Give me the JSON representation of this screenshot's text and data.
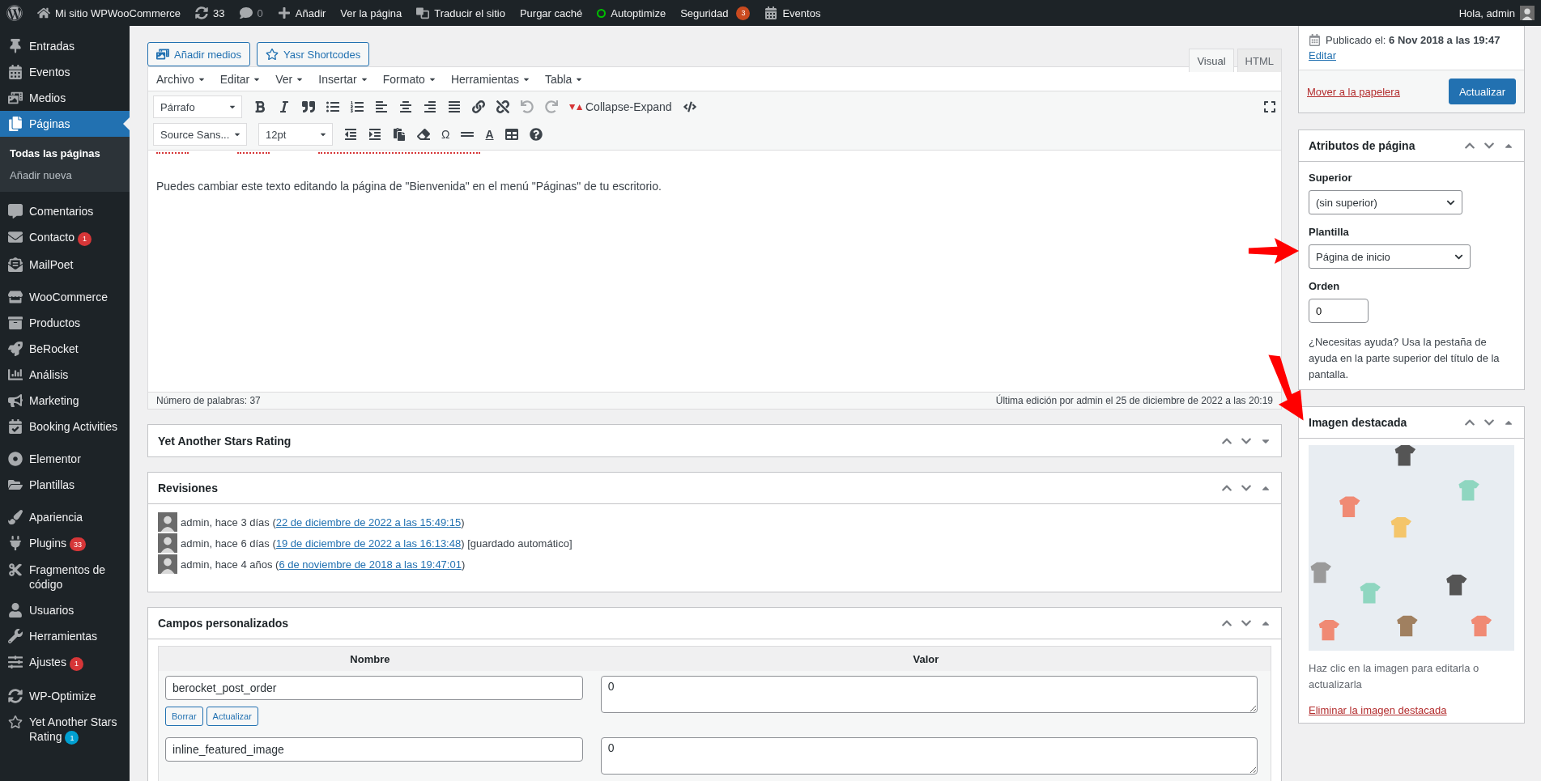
{
  "admin_bar": {
    "items": [
      {
        "kind": "logo"
      },
      {
        "kind": "icon_text",
        "label": "Mi sitio WPWooCommerce"
      },
      {
        "kind": "icon_text",
        "label": "33"
      },
      {
        "kind": "icon_count",
        "label": "0"
      },
      {
        "kind": "icon_text",
        "label": "Añadir"
      },
      {
        "kind": "text",
        "label": "Ver la página"
      },
      {
        "kind": "icon_text",
        "label": "Traducir el sitio"
      },
      {
        "kind": "text",
        "label": "Purgar caché"
      },
      {
        "kind": "status",
        "label": "Autoptimize"
      },
      {
        "kind": "badge",
        "label": "Seguridad",
        "badge": "3"
      },
      {
        "kind": "icon_text",
        "label": "Eventos"
      }
    ],
    "greeting": "Hola, admin"
  },
  "sidebar": {
    "groups": [
      [
        {
          "label": "Entradas",
          "selected": false
        },
        {
          "label": "Eventos",
          "selected": false
        },
        {
          "label": "Medios",
          "selected": false
        },
        {
          "label": "Páginas",
          "selected": true,
          "children": [
            {
              "label": "Todas las páginas",
              "selected": true
            },
            {
              "label": "Añadir nueva",
              "selected": false
            }
          ]
        }
      ],
      [
        {
          "label": "Comentarios",
          "selected": false
        },
        {
          "label": "Contacto",
          "selected": false,
          "badge": "1",
          "color": "#d63638"
        },
        {
          "label": "MailPoet",
          "selected": false
        }
      ],
      [
        {
          "label": "WooCommerce",
          "selected": false
        },
        {
          "label": "Productos",
          "selected": false
        },
        {
          "label": "BeRocket",
          "selected": false
        },
        {
          "label": "Análisis",
          "selected": false
        },
        {
          "label": "Marketing",
          "selected": false
        },
        {
          "label": "Booking Activities",
          "selected": false
        }
      ],
      [
        {
          "label": "Elementor",
          "selected": false
        },
        {
          "label": "Plantillas",
          "selected": false
        }
      ],
      [
        {
          "label": "Apariencia",
          "selected": false
        },
        {
          "label": "Plugins",
          "selected": false,
          "badge": "33",
          "color": "#d63638"
        },
        {
          "label": "Fragmentos de código",
          "selected": false
        },
        {
          "label": "Usuarios",
          "selected": false
        },
        {
          "label": "Herramientas",
          "selected": false
        },
        {
          "label": "Ajustes",
          "selected": false,
          "badge": "1",
          "color": "#d63638"
        }
      ],
      [
        {
          "label": "WP-Optimize",
          "selected": false
        },
        {
          "label": "Yet Another Stars Rating",
          "selected": false,
          "badge": "1",
          "color": "#00a0d2"
        }
      ]
    ]
  },
  "editor": {
    "media_buttons": [
      "Añadir medios",
      "Yasr Shortcodes"
    ],
    "tabs": [
      {
        "label": "Visual",
        "selected": true
      },
      {
        "label": "HTML",
        "selected": false
      }
    ],
    "menubar": [
      "Archivo",
      "Editar",
      "Ver",
      "Insertar",
      "Formato",
      "Herramientas",
      "Tabla"
    ],
    "toolbar": {
      "format_select": "Párrafo",
      "collapse_label": "Collapse-Expand",
      "font_select": "Source Sans...",
      "size_select": "12pt",
      "special_char": "Ω",
      "text_color": "A"
    },
    "content": "Puedes cambiar este texto editando la página de \"Bienvenida\" en el menú \"Páginas\" de tu escritorio.",
    "word_count": "Número de palabras: 37",
    "last_edit": "Última edición por admin el 25 de diciembre de 2022 a las 20:19"
  },
  "yasr_box": {
    "title": "Yet Another Stars Rating",
    "expanded": false
  },
  "revisions_box": {
    "title": "Revisiones",
    "expanded": true,
    "items": [
      {
        "before": "admin, hace 3 días (",
        "link": "22 de diciembre de 2022 a las 15:49:15",
        "after": ")"
      },
      {
        "before": "admin, hace 6 días (",
        "link": "19 de diciembre de 2022 a las 16:13:48",
        "after": ") [guardado automático]"
      },
      {
        "before": "admin, hace 4 años (",
        "link": "6 de noviembre de 2018 a las 19:47:01",
        "after": ")"
      }
    ]
  },
  "custom_fields_box": {
    "title": "Campos personalizados",
    "expanded": true,
    "columns": [
      "Nombre",
      "Valor"
    ],
    "rows": [
      {
        "name": "berocket_post_order",
        "value": "0",
        "buttons": [
          "Borrar",
          "Actualizar"
        ]
      },
      {
        "name": "inline_featured_image",
        "value": "0"
      }
    ]
  },
  "publish_box": {
    "published": "Publicado el: **6 Nov 2018 a las 19:47**",
    "edit_link": "Editar",
    "trash_link": "Mover a la papelera",
    "update_button": "Actualizar"
  },
  "attributes_box": {
    "title": "Atributos de página",
    "expanded": true,
    "parent_label": "Superior",
    "parent_value": "(sin superior)",
    "template_label": "Plantilla",
    "template_value": "Página de inicio",
    "order_label": "Orden",
    "order_value": "0",
    "help": "¿Necesitas ayuda? Usa la pestaña de ayuda en la parte superior del título de la pantalla."
  },
  "featured_box": {
    "title": "Imagen destacada",
    "expanded": true,
    "hint": "Haz clic en la imagen para editarla o actualizarla",
    "remove_link": "Eliminar la imagen destacada"
  }
}
